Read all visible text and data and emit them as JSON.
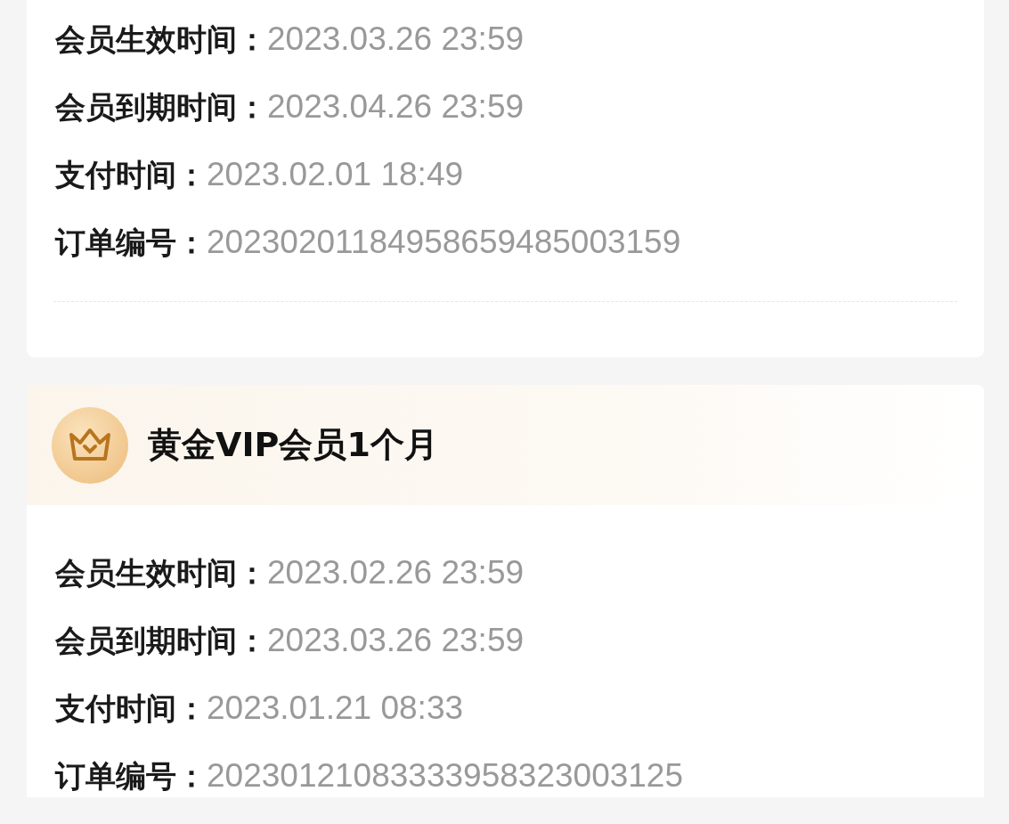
{
  "cards": [
    {
      "rows": [
        {
          "label": "会员生效时间：",
          "value": "2023.03.26 23:59"
        },
        {
          "label": "会员到期时间：",
          "value": "2023.04.26 23:59"
        },
        {
          "label": "支付时间：",
          "value": "2023.02.01 18:49"
        },
        {
          "label": "订单编号：",
          "value": "20230201184958659485003159"
        }
      ],
      "divider": true
    },
    {
      "title": "黄金VIP会员1个月",
      "rows": [
        {
          "label": "会员生效时间：",
          "value": "2023.02.26 23:59"
        },
        {
          "label": "会员到期时间：",
          "value": "2023.03.26 23:59"
        },
        {
          "label": "支付时间：",
          "value": "2023.01.21 08:33"
        },
        {
          "label": "订单编号：",
          "value": "20230121083333958323003125"
        }
      ]
    }
  ]
}
